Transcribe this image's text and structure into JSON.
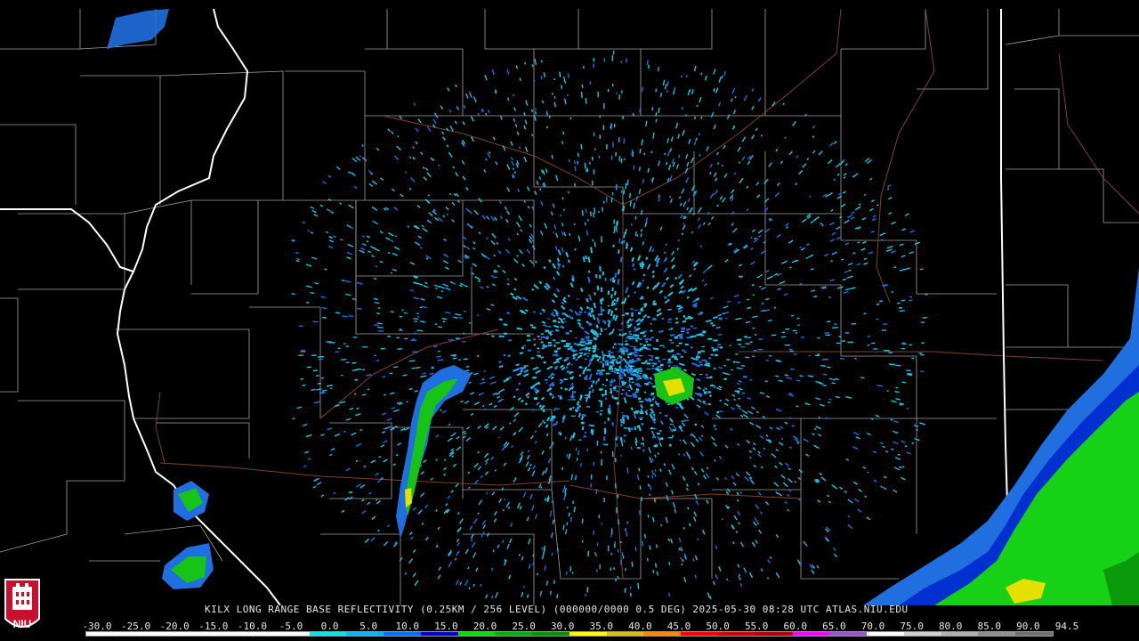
{
  "product": {
    "caption": "KILX LONG RANGE BASE REFLECTIVITY (0.25KM / 256 LEVEL) (000000/0000 0.5 DEG) 2025-05-30 08:28 UTC  ATLAS.NIU.EDU",
    "radar_site": "KILX",
    "timestamp": "2025-05-30 08:28 UTC"
  },
  "scale": {
    "labels": [
      "-30.0",
      "-25.0",
      "-20.0",
      "-15.0",
      "-10.0",
      "-5.0",
      "0.0",
      "5.0",
      "10.0",
      "15.0",
      "20.0",
      "25.0",
      "30.0",
      "35.0",
      "40.0",
      "45.0",
      "50.0",
      "55.0",
      "60.0",
      "65.0",
      "70.0",
      "75.0",
      "80.0",
      "85.0",
      "90.0",
      "94.5"
    ],
    "colors": [
      "#ffffff",
      "#ffffff",
      "#ffffff",
      "#ffffff",
      "#ffffff",
      "#ffffff",
      "#00e5e5",
      "#00b4ff",
      "#0070ff",
      "#0000d0",
      "#00e000",
      "#00b000",
      "#009000",
      "#ffff00",
      "#e0c000",
      "#ff8800",
      "#ff0000",
      "#d00000",
      "#b00000",
      "#ff00ff",
      "#9955cc",
      "#ffffff",
      "#d0d0d0",
      "#b0b0b0",
      "#909090",
      "#707070"
    ]
  },
  "logo": {
    "text": "NIU"
  },
  "colors": {
    "state_border": "#ffffff",
    "county_border": "#bdbdbd",
    "road": "#8b4a2b",
    "radar_cyan": "#1ec8dc",
    "radar_blue": "#1f6fe0",
    "radar_green": "#17d117",
    "radar_yellow": "#e6e000"
  }
}
